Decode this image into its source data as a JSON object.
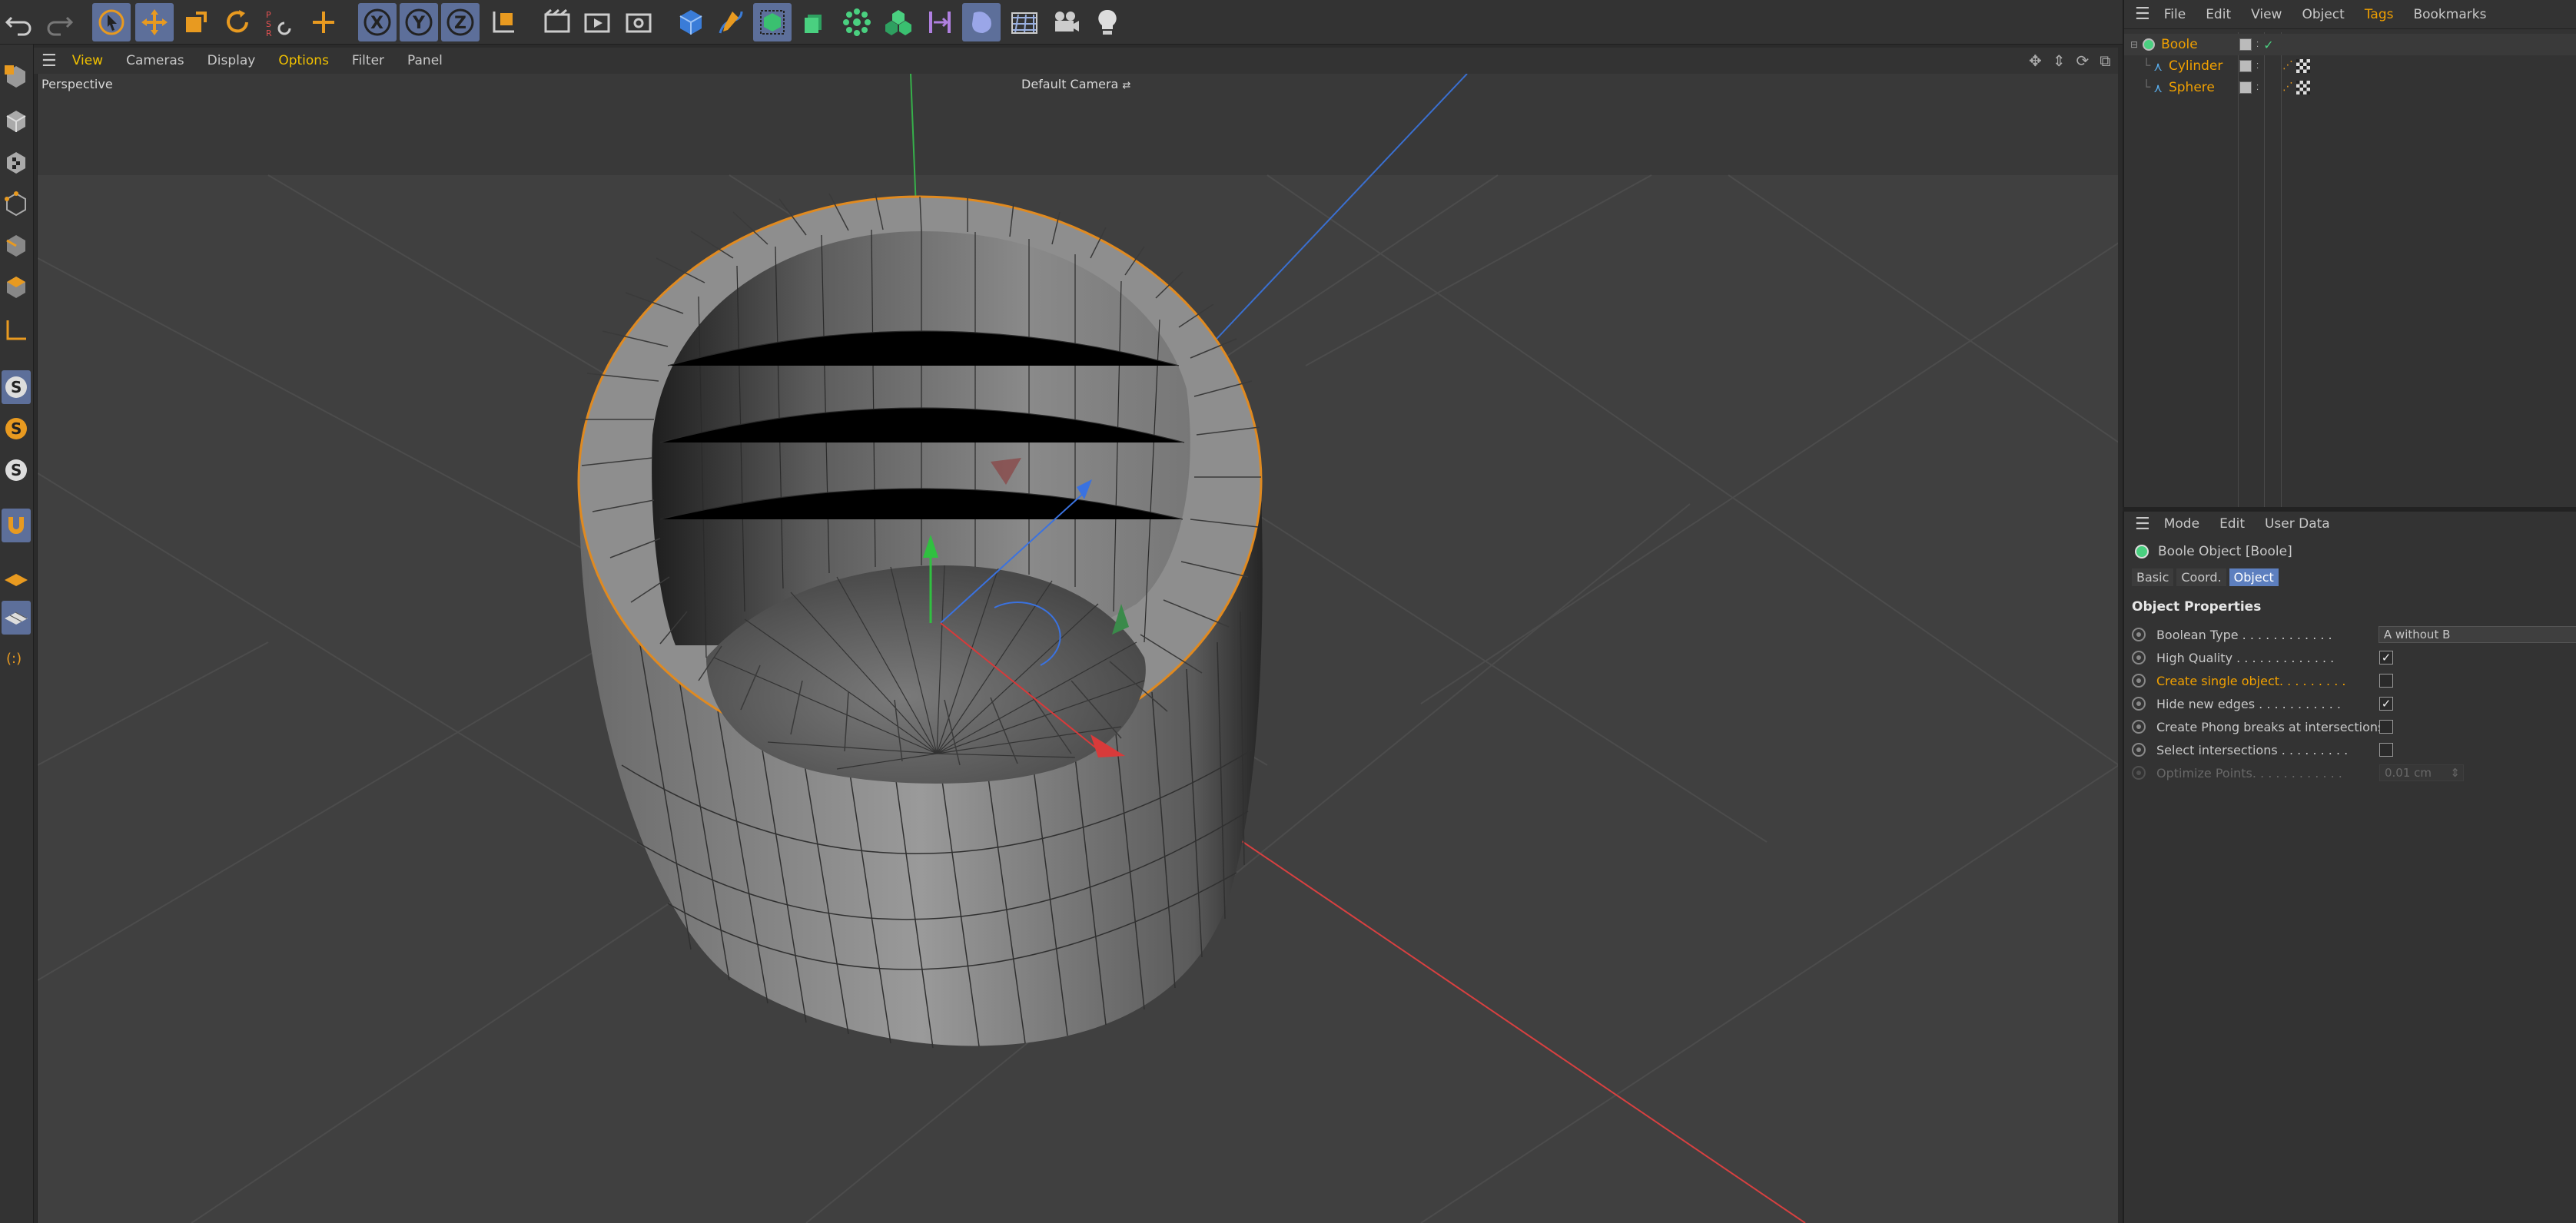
{
  "viewport": {
    "menu": [
      "View",
      "Cameras",
      "Display",
      "Options",
      "Filter",
      "Panel"
    ],
    "highlighted_menus": [
      "View",
      "Options"
    ],
    "label": "Perspective",
    "camera": "Default Camera"
  },
  "object_manager": {
    "menu": [
      "File",
      "Edit",
      "View",
      "Object",
      "Tags",
      "Bookmarks"
    ],
    "objects": [
      {
        "name": "Boole",
        "color": "#f0a000"
      },
      {
        "name": "Cylinder",
        "color": "#f0a000"
      },
      {
        "name": "Sphere",
        "color": "#f0a000"
      }
    ]
  },
  "attribute_manager": {
    "menu": [
      "Mode",
      "Edit",
      "User Data"
    ],
    "title": "Boole Object [Boole]",
    "tabs": [
      "Basic",
      "Coord.",
      "Object"
    ],
    "selected_tab": "Object",
    "section": "Object Properties",
    "properties": [
      {
        "label": "Boolean Type . . . . . . . . . . . .",
        "type": "dropdown",
        "value": "A without B"
      },
      {
        "label": "High Quality . . . . . . . . . . . . .",
        "type": "checkbox",
        "checked": true
      },
      {
        "label": "Create single object. . . . . . . . .",
        "type": "checkbox",
        "checked": false,
        "highlight": true
      },
      {
        "label": "Hide new edges . . . . . . . . . . .",
        "type": "checkbox",
        "checked": true
      },
      {
        "label": "Create Phong breaks at intersections",
        "type": "checkbox",
        "checked": false
      },
      {
        "label": "Select intersections . . . . . . . . .",
        "type": "checkbox",
        "checked": false
      },
      {
        "label": "Optimize Points. . . . . . . . . . . .",
        "type": "number",
        "value": "0.01 cm",
        "disabled": true
      }
    ]
  },
  "colors": {
    "accent": "#f0a000",
    "selection": "#5d7fbf",
    "axis_x": "#d83030",
    "axis_y": "#30c040",
    "axis_z": "#3070e0",
    "selection_outline": "#e08a20"
  }
}
